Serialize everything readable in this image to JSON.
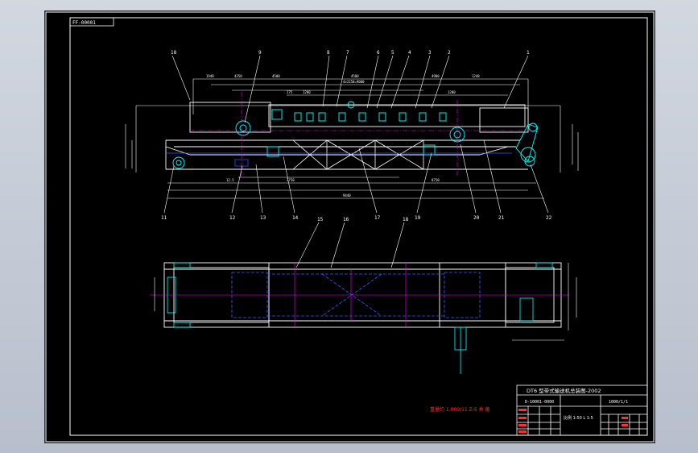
{
  "drawing": {
    "sheet_code": "FF-00001",
    "title_main": "DT6 型带式输送机总装图-2002",
    "drawing_number": "D-10001-0000",
    "sheet_no": "1000/1/1",
    "scale_note": "比例 1:50 L 1:5",
    "note": "重量约 1.000/11 Z-5 共 备"
  },
  "labels": {
    "top": [
      "18",
      "9",
      "8",
      "7",
      "6",
      "5",
      "4",
      "3",
      "2",
      "1"
    ],
    "bottom": [
      "11",
      "12",
      "13",
      "14",
      "17",
      "19",
      "20",
      "21",
      "22"
    ],
    "plan": [
      "15",
      "16",
      "18"
    ]
  },
  "colors": {
    "background": "#000000",
    "frame": "#ffffff",
    "dimension": "#ffffff",
    "centerline": "#ff00ff",
    "part": "#00ffff",
    "hidden": "#0000ff",
    "annotation": "#ff0000",
    "leader": "#ffff00"
  }
}
